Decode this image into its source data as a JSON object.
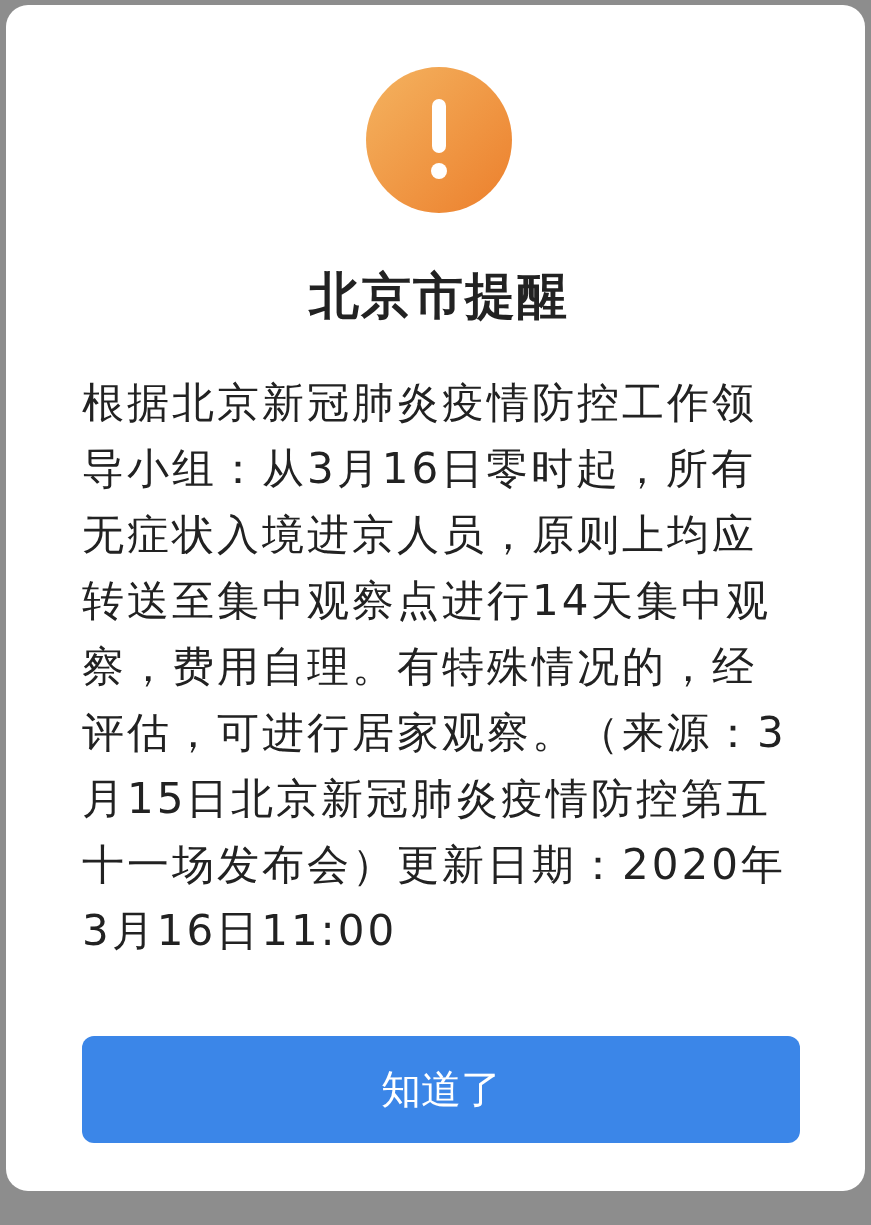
{
  "dialog": {
    "title": "北京市提醒",
    "message": "根据北京新冠肺炎疫情防控工作领导小组：从3月16日零时起，所有无症状入境进京人员，原则上均应转送至集中观察点进行14天集中观察，费用自理。有特殊情况的，经评估，可进行居家观察。（来源：3月15日北京新冠肺炎疫情防控第五十一场发布会）更新日期：2020年3月16日11:00",
    "buttons": [
      {
        "label": "知道了",
        "kind": "primary"
      }
    ]
  }
}
